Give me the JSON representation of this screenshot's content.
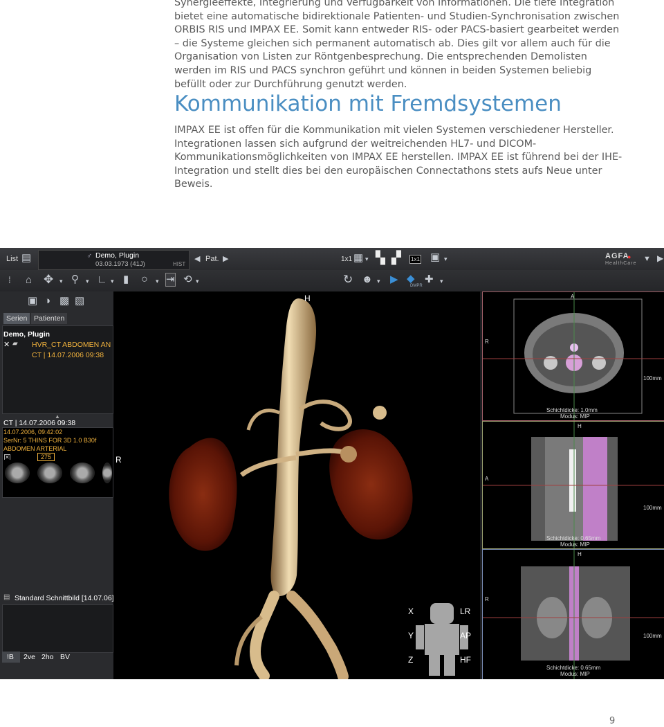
{
  "doc": {
    "paragraph1": "Synergieeffekte, Integrierung und Verfügbarkeit von Informationen. Die tiefe Integration bietet eine automatische bidirektionale Patienten- und Studien-Synchronisation zwischen ORBIS RIS und IMPAX EE. Somit kann entweder RIS- oder PACS-basiert gearbeitet werden – die Systeme gleichen sich permanent automatisch ab. Dies gilt vor allem auch für die Organisation von Listen zur Röntgenbesprechung. Die entsprechenden Demolisten werden im RIS und PACS synchron geführt und können in beiden Systemen beliebig befüllt oder zur Durchführung genutzt werden.",
    "heading": "Kommunikation mit Fremdsystemen",
    "paragraph2": "IMPAX EE ist offen für die Kommunikation mit vielen Systemen verschiedener Hersteller. Integrationen lassen sich aufgrund der weitreichenden HL7- und DICOM-Kommunikationsmöglichkeiten von IMPAX EE herstellen. IMPAX EE ist führend bei der IHE-Integration und stellt dies bei den europäischen Connectathons stets aufs Neue unter Beweis.",
    "page_number": "9"
  },
  "app": {
    "toolbar": {
      "list_label": "List",
      "patient_name": "Demo, Plugin",
      "patient_dob": "03.03.1973 (41J)",
      "hist_label": "HIST",
      "pat_label": "Pat.",
      "layout_label": "1x1",
      "layout_tile_label": "1x1",
      "brand": "AGFA",
      "brand_sub": "HealthCare",
      "mpr_label": "DMPR"
    },
    "left": {
      "tabs": [
        "Serien",
        "Patienten"
      ],
      "patient": "Demo, Plugin",
      "series_title": "HVR_CT ABDOMEN AN",
      "series_date": "CT | 14.07.2006 09:38",
      "study_header": "CT | 14.07.2006 09:38",
      "study_line1": "14.07.2006, 09:42:02",
      "study_line2": "SerNr: 5 THINS FOR 3D  1.0  B30f",
      "study_line3": "ABDOMEN ARTERIAL",
      "thumb_count": "275",
      "standard_label": "Standard Schnittbild [14.07.06]",
      "bottom_buttons": [
        "!B",
        "2ve",
        "2ho",
        "BV"
      ]
    },
    "view3d": {
      "top_marker": "H",
      "right_marker": "R",
      "axes": [
        "X",
        "Y",
        "Z"
      ],
      "axes_labels": [
        "LR",
        "AP",
        "HF"
      ]
    },
    "mpr": [
      {
        "top": "A",
        "left": "R",
        "scale": "100mm",
        "thickness": "Schichtdicke: 1.0mm",
        "mode": "Modus: MIP"
      },
      {
        "top": "H",
        "left": "A",
        "scale": "100mm",
        "thickness": "Schichtdicke: 0.65mm",
        "mode": "Modus: MIP"
      },
      {
        "top": "H",
        "left": "R",
        "scale": "100mm",
        "thickness": "Schichtdicke: 0.65mm",
        "mode": "Modus: MIP"
      }
    ],
    "colors": {
      "accent": "#4a8ec2",
      "orange": "#f2b33d",
      "mpr_border": "#7a8db5"
    }
  }
}
